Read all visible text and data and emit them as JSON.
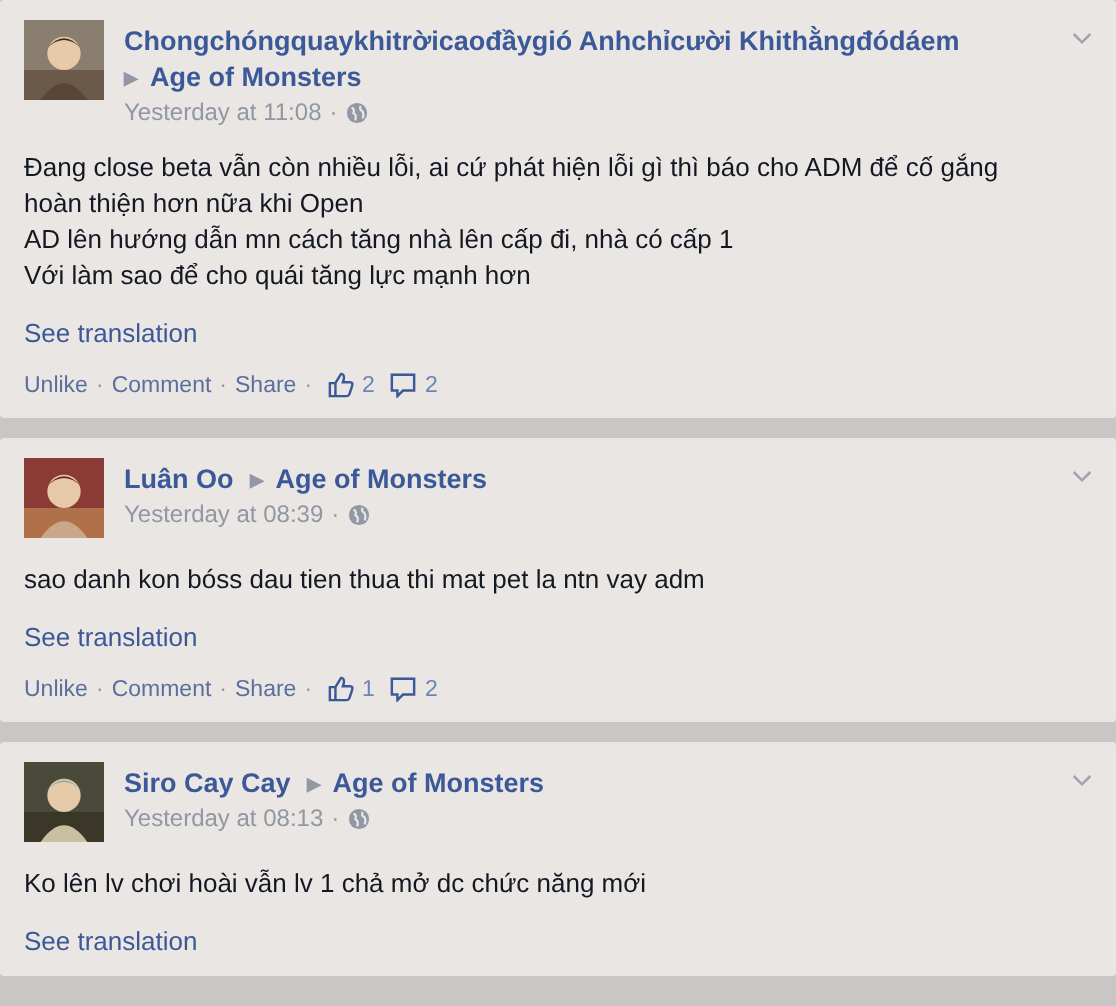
{
  "posts": [
    {
      "author": "Chongchóngquaykhitrờicaođầygió Anhchỉcười Khithằngđódáem",
      "arrow": "▶",
      "page": "Age of Monsters",
      "time": "Yesterday at 11:08",
      "time_separator": "·",
      "body": [
        "Đang close beta vẫn còn nhiều lỗi, ai cứ phát hiện lỗi gì thì báo cho ADM để cố gắng hoàn thiện hơn nữa khi Open",
        "AD lên hướng dẫn mn cách tăng nhà lên cấp đi, nhà có cấp 1",
        "Với làm sao để cho quái tăng lực mạnh hơn"
      ],
      "translation": "See translation",
      "actions": [
        {
          "kind": "link",
          "text": "Unlike"
        },
        {
          "kind": "separator",
          "text": "·"
        },
        {
          "kind": "link",
          "text": "Comment"
        },
        {
          "kind": "separator",
          "text": "·"
        },
        {
          "kind": "link",
          "text": "Share"
        },
        {
          "kind": "separator",
          "text": "·"
        }
      ],
      "likes": "2",
      "comments": "2"
    },
    {
      "author": "Luân Oo",
      "arrow": "▶",
      "page": "Age of Monsters",
      "time": "Yesterday at 08:39",
      "time_separator": "·",
      "body": [
        "sao danh kon bóss dau tien thua thi mat pet la ntn vay adm"
      ],
      "translation": "See translation",
      "actions": [
        {
          "kind": "link",
          "text": "Unlike"
        },
        {
          "kind": "separator",
          "text": "·"
        },
        {
          "kind": "link",
          "text": "Comment"
        },
        {
          "kind": "separator",
          "text": "·"
        },
        {
          "kind": "link",
          "text": "Share"
        },
        {
          "kind": "separator",
          "text": "·"
        }
      ],
      "likes": "1",
      "comments": "2"
    },
    {
      "author": "Siro Cay Cay",
      "arrow": "▶",
      "page": "Age of Monsters",
      "time": "Yesterday at 08:13",
      "time_separator": "·",
      "body": [
        "Ko lên lv chơi hoài vẫn lv 1 chả mở dc chức năng mới"
      ],
      "translation": "See translation"
    }
  ]
}
